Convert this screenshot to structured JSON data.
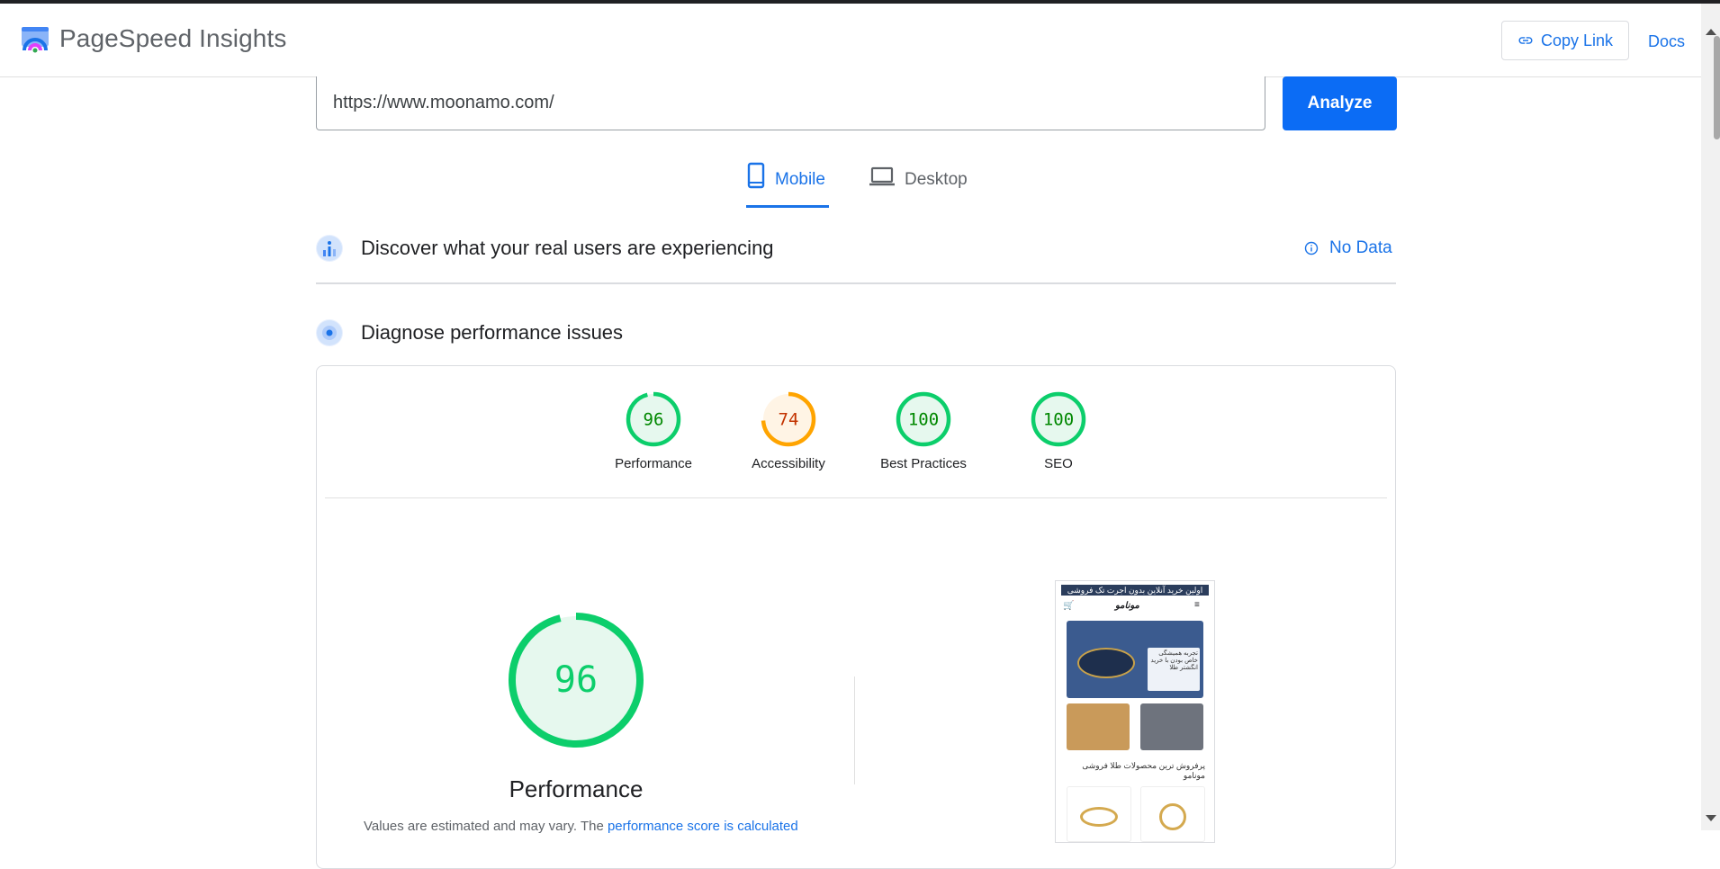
{
  "app": {
    "title": "PageSpeed Insights"
  },
  "header": {
    "copy_link": "Copy Link",
    "docs": "Docs"
  },
  "search": {
    "url_value": "https://www.moonamo.com/",
    "analyze": "Analyze"
  },
  "tabs": [
    {
      "label": "Mobile",
      "active": true,
      "icon": "smartphone-icon"
    },
    {
      "label": "Desktop",
      "active": false,
      "icon": "laptop-icon"
    }
  ],
  "field_data": {
    "title": "Discover what your real users are experiencing",
    "status": "No Data"
  },
  "lab_data": {
    "title": "Diagnose performance issues"
  },
  "scores": [
    {
      "label": "Performance",
      "value": "96",
      "fraction": 0.96,
      "color": "#0cce6b",
      "text_color": "#008800",
      "bg": "#e6f8ee"
    },
    {
      "label": "Accessibility",
      "value": "74",
      "fraction": 0.74,
      "color": "#ffa400",
      "text_color": "#c33300",
      "bg": "#fff4e5"
    },
    {
      "label": "Best Practices",
      "value": "100",
      "fraction": 1.0,
      "color": "#0cce6b",
      "text_color": "#008800",
      "bg": "#e6f8ee"
    },
    {
      "label": "SEO",
      "value": "100",
      "fraction": 1.0,
      "color": "#0cce6b",
      "text_color": "#008800",
      "bg": "#e6f8ee"
    }
  ],
  "performance": {
    "score": "96",
    "fraction": 0.96,
    "label": "Performance",
    "note_prefix": "Values are estimated and may vary. The ",
    "note_link": "performance score is calculated"
  },
  "screenshot": {
    "banner": "اولین خرید آنلاین بدون اجرت تک فروشی",
    "brand": "مونامو",
    "hero_text": "تجربه همیشگی خاص بودن با خرید انگشتر طلا",
    "caption": "پرفروش ترین محصولات طلا فروشی مونامو"
  },
  "colors": {
    "accent": "#1a73e8",
    "analyze_bg": "#0b6cf5",
    "pass": "#0cce6b",
    "average": "#ffa400"
  }
}
